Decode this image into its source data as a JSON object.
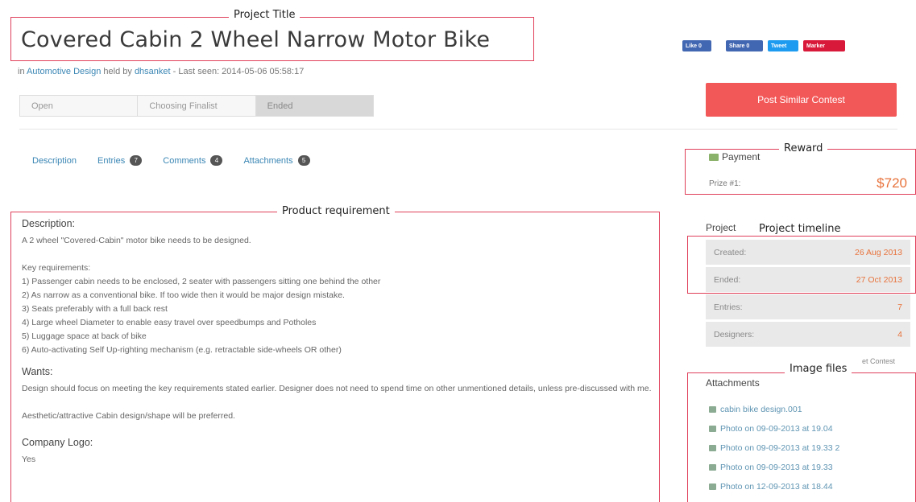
{
  "annotations": {
    "project_title": "Project Title",
    "product_requirement": "Product requirement",
    "reward": "Reward",
    "project_timeline": "Project timeline",
    "image_files": "Image files"
  },
  "header": {
    "title": "Covered Cabin 2 Wheel Narrow Motor Bike",
    "meta_in": "in ",
    "category": "Automotive Design",
    "meta_held": " held by ",
    "user": "dhsanket",
    "meta_seen": " - Last seen: 2014-05-06 05:58:17"
  },
  "social": {
    "like": "Like 0",
    "share": "Share 0",
    "tweet": "Tweet",
    "marker": "Marker"
  },
  "progress": {
    "steps": [
      "Open",
      "Choosing Finalist",
      "Ended"
    ],
    "active_step": "Ended"
  },
  "post_button": "Post Similar Contest",
  "tabs": [
    {
      "label": "Description",
      "count": ""
    },
    {
      "label": "Entries",
      "count": "7"
    },
    {
      "label": "Comments",
      "count": "4"
    },
    {
      "label": "Attachments",
      "count": "5"
    }
  ],
  "content": {
    "description_title": "Description:",
    "description_text": "A 2 wheel \"Covered-Cabin\" motor bike needs to be designed.",
    "key_req_title": "Key requirements:",
    "requirements": [
      "1) Passenger cabin needs to be enclosed, 2 seater with passengers sitting one behind the other",
      "2) As narrow as a conventional bike. If too wide then it would be major design mistake.",
      "3) Seats preferably with a full back rest",
      "4) Large wheel Diameter to enable easy travel over speedbumps and Potholes",
      "5) Luggage space at back of bike",
      "6) Auto-activating Self Up-righting mechanism (e.g. retractable side-wheels OR other)"
    ],
    "wants_title": "Wants:",
    "wants_text_1": "Design should focus on meeting the key requirements stated earlier. Designer does not need to spend time on other unmentioned details, unless pre-discussed with me.",
    "wants_text_2": "Aesthetic/attractive Cabin design/shape will be preferred.",
    "logo_title": "Company Logo:",
    "logo_text": "Yes"
  },
  "payment": {
    "title": "Payment",
    "prize_label": "Prize #1:",
    "prize_value": "$720"
  },
  "project": {
    "title": "Project",
    "rows": [
      {
        "label": "Created:",
        "value": "26 Aug 2013"
      },
      {
        "label": "Ended:",
        "value": "27 Oct 2013"
      },
      {
        "label": "Entries:",
        "value": "7"
      },
      {
        "label": "Designers:",
        "value": "4"
      }
    ],
    "contest_fragment": "et Contest"
  },
  "attachments": {
    "title": "Attachments",
    "files": [
      "cabin bike design.001",
      "Photo on 09-09-2013 at 19.04",
      "Photo on 09-09-2013 at 19.33 2",
      "Photo on 09-09-2013 at 19.33",
      "Photo on 12-09-2013 at 18.44"
    ]
  },
  "colors": {
    "annotation": "#e0405a",
    "accent_link": "#3a86b4",
    "post_button": "#f35858",
    "prize": "#e8733c"
  }
}
